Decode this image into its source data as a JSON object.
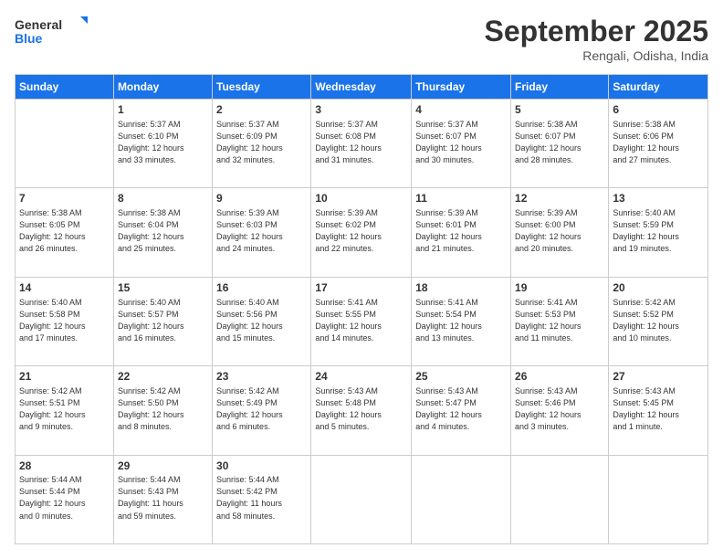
{
  "logo": {
    "line1": "General",
    "line2": "Blue"
  },
  "header": {
    "month": "September 2025",
    "location": "Rengali, Odisha, India"
  },
  "days": [
    "Sunday",
    "Monday",
    "Tuesday",
    "Wednesday",
    "Thursday",
    "Friday",
    "Saturday"
  ],
  "weeks": [
    [
      {
        "day": "",
        "info": ""
      },
      {
        "day": "1",
        "info": "Sunrise: 5:37 AM\nSunset: 6:10 PM\nDaylight: 12 hours\nand 33 minutes."
      },
      {
        "day": "2",
        "info": "Sunrise: 5:37 AM\nSunset: 6:09 PM\nDaylight: 12 hours\nand 32 minutes."
      },
      {
        "day": "3",
        "info": "Sunrise: 5:37 AM\nSunset: 6:08 PM\nDaylight: 12 hours\nand 31 minutes."
      },
      {
        "day": "4",
        "info": "Sunrise: 5:37 AM\nSunset: 6:07 PM\nDaylight: 12 hours\nand 30 minutes."
      },
      {
        "day": "5",
        "info": "Sunrise: 5:38 AM\nSunset: 6:07 PM\nDaylight: 12 hours\nand 28 minutes."
      },
      {
        "day": "6",
        "info": "Sunrise: 5:38 AM\nSunset: 6:06 PM\nDaylight: 12 hours\nand 27 minutes."
      }
    ],
    [
      {
        "day": "7",
        "info": "Sunrise: 5:38 AM\nSunset: 6:05 PM\nDaylight: 12 hours\nand 26 minutes."
      },
      {
        "day": "8",
        "info": "Sunrise: 5:38 AM\nSunset: 6:04 PM\nDaylight: 12 hours\nand 25 minutes."
      },
      {
        "day": "9",
        "info": "Sunrise: 5:39 AM\nSunset: 6:03 PM\nDaylight: 12 hours\nand 24 minutes."
      },
      {
        "day": "10",
        "info": "Sunrise: 5:39 AM\nSunset: 6:02 PM\nDaylight: 12 hours\nand 22 minutes."
      },
      {
        "day": "11",
        "info": "Sunrise: 5:39 AM\nSunset: 6:01 PM\nDaylight: 12 hours\nand 21 minutes."
      },
      {
        "day": "12",
        "info": "Sunrise: 5:39 AM\nSunset: 6:00 PM\nDaylight: 12 hours\nand 20 minutes."
      },
      {
        "day": "13",
        "info": "Sunrise: 5:40 AM\nSunset: 5:59 PM\nDaylight: 12 hours\nand 19 minutes."
      }
    ],
    [
      {
        "day": "14",
        "info": "Sunrise: 5:40 AM\nSunset: 5:58 PM\nDaylight: 12 hours\nand 17 minutes."
      },
      {
        "day": "15",
        "info": "Sunrise: 5:40 AM\nSunset: 5:57 PM\nDaylight: 12 hours\nand 16 minutes."
      },
      {
        "day": "16",
        "info": "Sunrise: 5:40 AM\nSunset: 5:56 PM\nDaylight: 12 hours\nand 15 minutes."
      },
      {
        "day": "17",
        "info": "Sunrise: 5:41 AM\nSunset: 5:55 PM\nDaylight: 12 hours\nand 14 minutes."
      },
      {
        "day": "18",
        "info": "Sunrise: 5:41 AM\nSunset: 5:54 PM\nDaylight: 12 hours\nand 13 minutes."
      },
      {
        "day": "19",
        "info": "Sunrise: 5:41 AM\nSunset: 5:53 PM\nDaylight: 12 hours\nand 11 minutes."
      },
      {
        "day": "20",
        "info": "Sunrise: 5:42 AM\nSunset: 5:52 PM\nDaylight: 12 hours\nand 10 minutes."
      }
    ],
    [
      {
        "day": "21",
        "info": "Sunrise: 5:42 AM\nSunset: 5:51 PM\nDaylight: 12 hours\nand 9 minutes."
      },
      {
        "day": "22",
        "info": "Sunrise: 5:42 AM\nSunset: 5:50 PM\nDaylight: 12 hours\nand 8 minutes."
      },
      {
        "day": "23",
        "info": "Sunrise: 5:42 AM\nSunset: 5:49 PM\nDaylight: 12 hours\nand 6 minutes."
      },
      {
        "day": "24",
        "info": "Sunrise: 5:43 AM\nSunset: 5:48 PM\nDaylight: 12 hours\nand 5 minutes."
      },
      {
        "day": "25",
        "info": "Sunrise: 5:43 AM\nSunset: 5:47 PM\nDaylight: 12 hours\nand 4 minutes."
      },
      {
        "day": "26",
        "info": "Sunrise: 5:43 AM\nSunset: 5:46 PM\nDaylight: 12 hours\nand 3 minutes."
      },
      {
        "day": "27",
        "info": "Sunrise: 5:43 AM\nSunset: 5:45 PM\nDaylight: 12 hours\nand 1 minute."
      }
    ],
    [
      {
        "day": "28",
        "info": "Sunrise: 5:44 AM\nSunset: 5:44 PM\nDaylight: 12 hours\nand 0 minutes."
      },
      {
        "day": "29",
        "info": "Sunrise: 5:44 AM\nSunset: 5:43 PM\nDaylight: 11 hours\nand 59 minutes."
      },
      {
        "day": "30",
        "info": "Sunrise: 5:44 AM\nSunset: 5:42 PM\nDaylight: 11 hours\nand 58 minutes."
      },
      {
        "day": "",
        "info": ""
      },
      {
        "day": "",
        "info": ""
      },
      {
        "day": "",
        "info": ""
      },
      {
        "day": "",
        "info": ""
      }
    ]
  ]
}
